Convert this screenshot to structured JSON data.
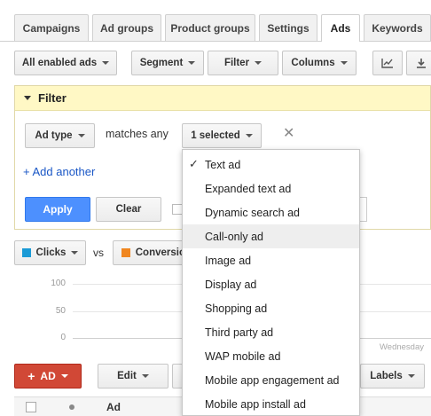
{
  "tabs": [
    {
      "label": "Campaigns",
      "active": false
    },
    {
      "label": "Ad groups",
      "active": false
    },
    {
      "label": "Product groups",
      "active": false
    },
    {
      "label": "Settings",
      "active": false
    },
    {
      "label": "Ads",
      "active": true
    },
    {
      "label": "Keywords",
      "active": false
    }
  ],
  "toolbar": {
    "status_filter": "All enabled ads",
    "segment": "Segment",
    "filter": "Filter",
    "columns": "Columns"
  },
  "filter_panel": {
    "title": "Filter",
    "field": "Ad type",
    "operator": "matches any",
    "selection": "1 selected",
    "add_another": "+ Add another",
    "apply": "Apply",
    "clear": "Clear"
  },
  "chart": {
    "metric1": "Clicks",
    "metric1_color": "#1a9ad6",
    "vs": "vs",
    "metric2": "Conversion",
    "metric2_color": "#f0861f",
    "y_ticks": [
      "100",
      "50",
      "0"
    ],
    "x_label": "Wednesday"
  },
  "ad_type_options": [
    {
      "label": "Text ad",
      "checked": true
    },
    {
      "label": "Expanded text ad",
      "checked": false
    },
    {
      "label": "Dynamic search ad",
      "checked": false
    },
    {
      "label": "Call-only ad",
      "checked": false,
      "hovered": true
    },
    {
      "label": "Image ad",
      "checked": false
    },
    {
      "label": "Display ad",
      "checked": false
    },
    {
      "label": "Shopping ad",
      "checked": false
    },
    {
      "label": "Third party ad",
      "checked": false
    },
    {
      "label": "WAP mobile ad",
      "checked": false
    },
    {
      "label": "Mobile app engagement ad",
      "checked": false
    },
    {
      "label": "Mobile app install ad",
      "checked": false
    }
  ],
  "table_toolbar": {
    "add_ad": "AD",
    "edit": "Edit",
    "labels": "Labels"
  },
  "table": {
    "col_ad": "Ad"
  }
}
